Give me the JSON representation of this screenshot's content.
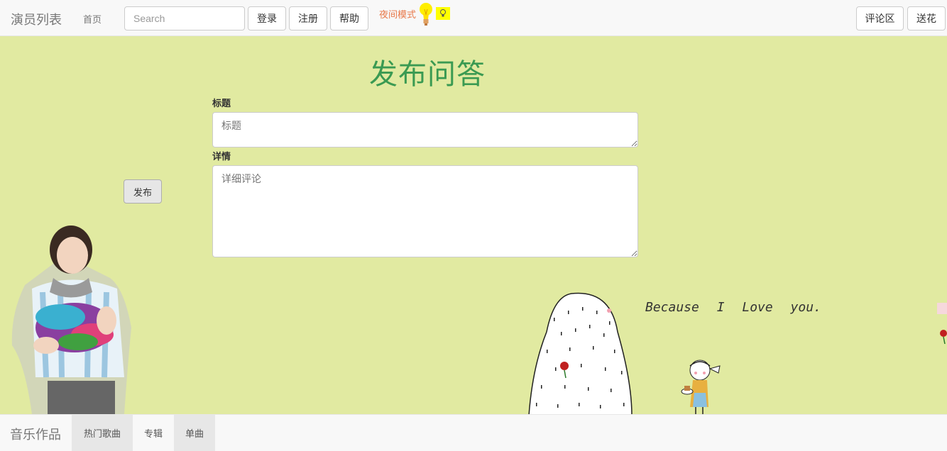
{
  "navbar": {
    "brand": "演员列表",
    "home": "首页",
    "search_placeholder": "Search",
    "login": "登录",
    "register": "注册",
    "help": "帮助",
    "night_mode": "夜间模式",
    "comments": "评论区",
    "send_flowers": "送花"
  },
  "form": {
    "heading": "发布问答",
    "title_label": "标题",
    "title_placeholder": "标题",
    "detail_label": "详情",
    "detail_placeholder": "详细评论",
    "publish": "发布"
  },
  "decor": {
    "caption": "Because I Love you."
  },
  "bottombar": {
    "brand": "音乐作品",
    "tabs": [
      "热门歌曲",
      "专辑",
      "单曲"
    ]
  },
  "colors": {
    "background": "#e1eaa1",
    "heading": "#3a9a52",
    "night_mode": "#e8794a",
    "bulb": "#ffff00"
  }
}
